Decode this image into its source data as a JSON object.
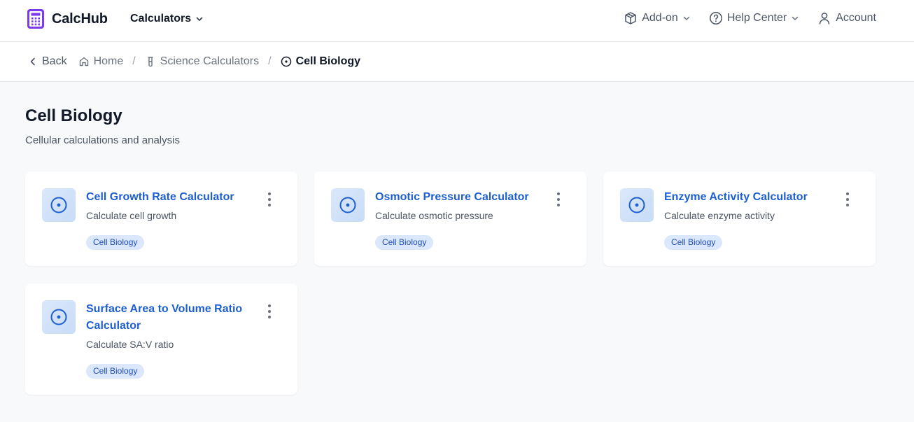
{
  "header": {
    "brand": "CalcHub",
    "nav_calculators": "Calculators",
    "addon": "Add-on",
    "help": "Help Center",
    "account": "Account"
  },
  "breadcrumb": {
    "back": "Back",
    "home": "Home",
    "science": "Science Calculators",
    "current": "Cell Biology"
  },
  "page": {
    "title": "Cell Biology",
    "subtitle": "Cellular calculations and analysis"
  },
  "cards": [
    {
      "title": "Cell Growth Rate Calculator",
      "desc": "Calculate cell growth",
      "tag": "Cell Biology"
    },
    {
      "title": "Osmotic Pressure Calculator",
      "desc": "Calculate osmotic pressure",
      "tag": "Cell Biology"
    },
    {
      "title": "Enzyme Activity Calculator",
      "desc": "Calculate enzyme activity",
      "tag": "Cell Biology"
    },
    {
      "title": "Surface Area to Volume Ratio Calculator",
      "desc": "Calculate SA:V ratio",
      "tag": "Cell Biology"
    }
  ],
  "colors": {
    "brand_accent": "#7c3aed",
    "link_blue": "#1d5fd1",
    "tag_bg": "#dbe7fb"
  },
  "icons": {
    "brand": "calculator-icon",
    "card": "target-icon",
    "menu": "kebab-menu-icon"
  }
}
